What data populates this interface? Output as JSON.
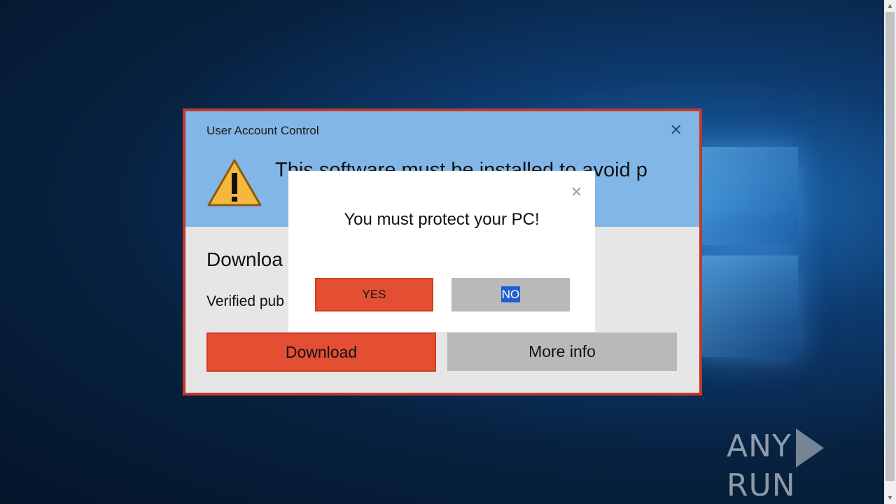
{
  "uac": {
    "title": "User Account Control",
    "close_glyph": "✕",
    "heading": "This software must be installed to avoid p",
    "subheading": "Downloa",
    "verified": "Verified pub",
    "download_label": "Download",
    "more_info_label": "More info",
    "warning_icon": "warning-triangle-icon"
  },
  "popup": {
    "close_glyph": "✕",
    "message": "You must protect your PC!",
    "yes_label": "YES",
    "no_label": "NO"
  },
  "watermark": {
    "left_text": "ANY",
    "right_text": "RUN"
  },
  "colors": {
    "accent_red": "#e44f34",
    "header_blue": "#82b6e6",
    "button_gray": "#b9b9b9",
    "border_red": "#c0392b"
  }
}
